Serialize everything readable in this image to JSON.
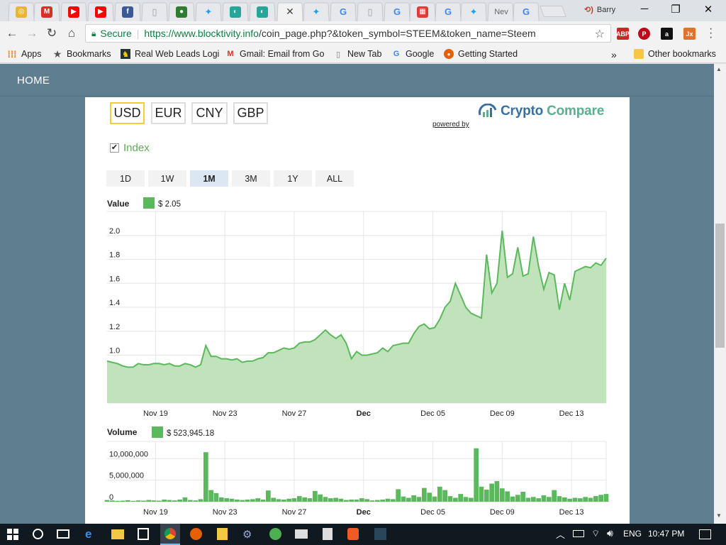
{
  "browser": {
    "tabs": [
      {
        "icon": "tab-favicon",
        "color": "#e8b43a",
        "glyph": "◎"
      },
      {
        "icon": "gmail-icon",
        "color": "#d93025",
        "glyph": "M"
      },
      {
        "icon": "youtube-icon",
        "color": "#ff0000",
        "glyph": "▶"
      },
      {
        "icon": "youtube-icon",
        "color": "#ff0000",
        "glyph": "▶"
      },
      {
        "icon": "facebook-icon",
        "color": "#3b5998",
        "glyph": "f"
      },
      {
        "icon": "document-icon",
        "color": "#9e9e9e",
        "glyph": "▯"
      },
      {
        "icon": "tab-favicon",
        "color": "#2e7d32",
        "glyph": "●"
      },
      {
        "icon": "twitter-icon",
        "color": "#1da1f2",
        "glyph": "✦"
      },
      {
        "icon": "tab-favicon",
        "color": "#26a69a",
        "glyph": "◐"
      },
      {
        "icon": "tab-favicon",
        "color": "#26a69a",
        "glyph": "◐"
      },
      {
        "icon": "close-icon",
        "color": "#444444",
        "glyph": "✕"
      },
      {
        "icon": "twitter-icon",
        "color": "#1da1f2",
        "glyph": "✦"
      },
      {
        "icon": "google-icon",
        "color": "#4285f4",
        "glyph": "G"
      },
      {
        "icon": "document-icon",
        "color": "#9e9e9e",
        "glyph": "▯"
      },
      {
        "icon": "google-icon",
        "color": "#4285f4",
        "glyph": "G"
      },
      {
        "icon": "tab-favicon",
        "color": "#e53935",
        "glyph": "▦"
      },
      {
        "icon": "google-icon",
        "color": "#4285f4",
        "glyph": "G"
      },
      {
        "icon": "twitter-icon",
        "color": "#1da1f2",
        "glyph": "✦"
      },
      {
        "icon": "tab-title",
        "color": "#666666",
        "glyph": "",
        "title": "Nev"
      },
      {
        "icon": "google-icon",
        "color": "#4285f4",
        "glyph": "G"
      }
    ],
    "profile_name": "Barry",
    "secure_label": "Secure",
    "url_host": "https://www.blocktivity.info",
    "url_path": "/coin_page.php?&token_symbol=STEEM&token_name=Steem",
    "bookmarks": [
      {
        "label": "Apps",
        "icon": "apps-icon"
      },
      {
        "label": "Bookmarks",
        "icon": "star-icon"
      },
      {
        "label": "Real Web Leads Logi",
        "icon": "bookmark-favicon"
      },
      {
        "label": "Gmail: Email from Go",
        "icon": "gmail-icon"
      },
      {
        "label": "New Tab",
        "icon": "document-icon"
      },
      {
        "label": "Google",
        "icon": "google-icon"
      },
      {
        "label": "Getting Started",
        "icon": "firefox-icon"
      }
    ],
    "other_bookmarks": "Other bookmarks",
    "overflow": "»"
  },
  "page": {
    "nav_home": "HOME",
    "currencies": [
      "USD",
      "EUR",
      "CNY",
      "GBP"
    ],
    "selected_currency": "USD",
    "powered_by": "powered by",
    "brand_part1": "Crypto",
    "brand_part2": "Compare",
    "index_checked": true,
    "index_label": "Index",
    "ranges": [
      "1D",
      "1W",
      "1M",
      "3M",
      "1Y",
      "ALL"
    ],
    "selected_range": "1M",
    "colors": {
      "series": "#5cb85c",
      "area": "#c1e3bc",
      "selected_currency_border": "#f0cf3a"
    }
  },
  "taskbar": {
    "time": "10:47 PM",
    "lang": "ENG"
  },
  "chart_data": [
    {
      "type": "area",
      "title": "Value",
      "legend": "$ 2.05",
      "ylim": [
        0.6,
        2.2
      ],
      "yticks": [
        0.6,
        0.8,
        1.0,
        1.2,
        1.4,
        1.6,
        1.8,
        2.0
      ],
      "xticks": [
        "Nov 19",
        "Nov 23",
        "Nov 27",
        "Dec",
        "Dec 05",
        "Dec 09",
        "Dec 13"
      ],
      "xlim_days": [
        16.2,
        45.0
      ],
      "x": [
        16.2,
        16.5,
        16.8,
        17.1,
        17.4,
        17.7,
        18.0,
        18.3,
        18.6,
        18.9,
        19.2,
        19.5,
        19.8,
        20.1,
        20.4,
        20.7,
        21.0,
        21.3,
        21.6,
        21.9,
        22.2,
        22.5,
        22.8,
        23.1,
        23.4,
        23.7,
        24.0,
        24.3,
        24.6,
        24.9,
        25.2,
        25.5,
        25.8,
        26.1,
        26.4,
        26.7,
        27.0,
        27.3,
        27.6,
        27.9,
        28.2,
        28.5,
        28.8,
        29.1,
        29.4,
        29.7,
        30.0,
        30.3,
        30.6,
        30.9,
        31.2,
        31.5,
        31.8,
        32.1,
        32.4,
        32.7,
        33.0,
        33.3,
        33.6,
        33.9,
        34.2,
        34.5,
        34.8,
        35.1,
        35.4,
        35.7,
        36.0,
        36.3,
        36.6,
        36.9,
        37.2,
        37.5,
        37.8,
        38.1,
        38.4,
        38.7,
        39.0,
        39.3,
        39.6,
        39.9,
        40.2,
        40.5,
        40.8,
        41.1,
        41.4,
        41.7,
        42.0,
        42.3,
        42.6,
        42.9,
        43.2,
        43.5,
        43.8,
        44.1,
        44.4,
        44.7,
        45.0
      ],
      "values": [
        0.95,
        0.94,
        0.93,
        0.91,
        0.9,
        0.9,
        0.93,
        0.92,
        0.92,
        0.93,
        0.93,
        0.92,
        0.93,
        0.91,
        0.91,
        0.93,
        0.92,
        0.9,
        0.92,
        1.08,
        0.99,
        0.99,
        0.97,
        0.97,
        0.96,
        0.97,
        0.94,
        0.95,
        0.95,
        0.97,
        0.98,
        1.02,
        1.02,
        1.04,
        1.06,
        1.05,
        1.06,
        1.1,
        1.11,
        1.11,
        1.13,
        1.17,
        1.21,
        1.17,
        1.14,
        1.17,
        1.1,
        0.97,
        1.03,
        1.0,
        1.0,
        1.01,
        1.02,
        1.06,
        1.03,
        1.08,
        1.09,
        1.1,
        1.1,
        1.18,
        1.24,
        1.26,
        1.22,
        1.23,
        1.3,
        1.4,
        1.45,
        1.6,
        1.5,
        1.4,
        1.35,
        1.33,
        1.31,
        1.84,
        1.52,
        1.6,
        2.04,
        1.65,
        1.68,
        1.9,
        1.66,
        1.68,
        1.99,
        1.74,
        1.55,
        1.69,
        1.67,
        1.38,
        1.6,
        1.46,
        1.7,
        1.72,
        1.74,
        1.73,
        1.77,
        1.75,
        1.81,
        1.79,
        1.77,
        1.77,
        1.84,
        1.97,
        1.91,
        1.86,
        1.92,
        2.05
      ],
      "note_values_series_name": "Value"
    },
    {
      "type": "bar",
      "title": "Volume",
      "legend": "$ 523,945.18",
      "ylim": [
        0,
        14000000
      ],
      "yticks": [
        0,
        5000000,
        10000000
      ],
      "ytick_labels": [
        "0",
        "5,000,000",
        "10,000,000"
      ],
      "xticks": [
        "Nov 19",
        "Nov 23",
        "Nov 27",
        "Dec",
        "Dec 05",
        "Dec 09",
        "Dec 13"
      ],
      "x_start_day": 16.2,
      "x_step": 0.3,
      "values": [
        400000,
        300000,
        200000,
        250000,
        350000,
        200000,
        300000,
        250000,
        400000,
        300000,
        250000,
        500000,
        400000,
        300000,
        500000,
        1000000,
        400000,
        300000,
        600000,
        11500000,
        2700000,
        2000000,
        1000000,
        800000,
        700000,
        500000,
        400000,
        500000,
        600000,
        800000,
        500000,
        2600000,
        900000,
        600000,
        500000,
        700000,
        800000,
        1300000,
        1000000,
        800000,
        2500000,
        1700000,
        1100000,
        800000,
        900000,
        700000,
        400000,
        500000,
        500000,
        800000,
        600000,
        300000,
        400000,
        500000,
        700000,
        600000,
        2900000,
        1200000,
        900000,
        1500000,
        1100000,
        3200000,
        2100000,
        1200000,
        3500000,
        2700000,
        1300000,
        900000,
        1800000,
        1100000,
        900000,
        12400000,
        3500000,
        2800000,
        4200000,
        4800000,
        3100000,
        2400000,
        1200000,
        1600000,
        2300000,
        900000,
        1100000,
        800000,
        1500000,
        1100000,
        2700000,
        1300000,
        1000000,
        700000,
        900000,
        800000,
        1100000,
        900000,
        1300000,
        1600000,
        1800000,
        2300000,
        2000000,
        1300000,
        900000,
        800000,
        700000
      ]
    }
  ]
}
